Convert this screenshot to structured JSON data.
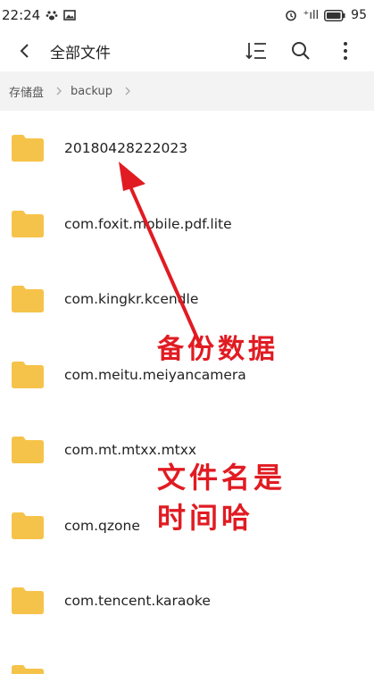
{
  "status_bar": {
    "time": "22:24",
    "battery": "95",
    "signal_text": "⁺ıll"
  },
  "header": {
    "title": "全部文件"
  },
  "breadcrumb": {
    "root": "存储盘",
    "current": "backup"
  },
  "files": [
    {
      "name": "20180428222023"
    },
    {
      "name": "com.foxit.mobile.pdf.lite"
    },
    {
      "name": "com.kingkr.kcendle"
    },
    {
      "name": "com.meitu.meiyancamera"
    },
    {
      "name": "com.mt.mtxx.mtxx"
    },
    {
      "name": "com.qzone"
    },
    {
      "name": "com.tencent.karaoke"
    }
  ],
  "annotations": {
    "line1": "备份数据",
    "line2": "文件名是",
    "line3": "时间哈",
    "color": "#e11b22"
  },
  "colors": {
    "folder": "#f6c34a",
    "breadcrumb_bg": "#f3f3f3"
  }
}
